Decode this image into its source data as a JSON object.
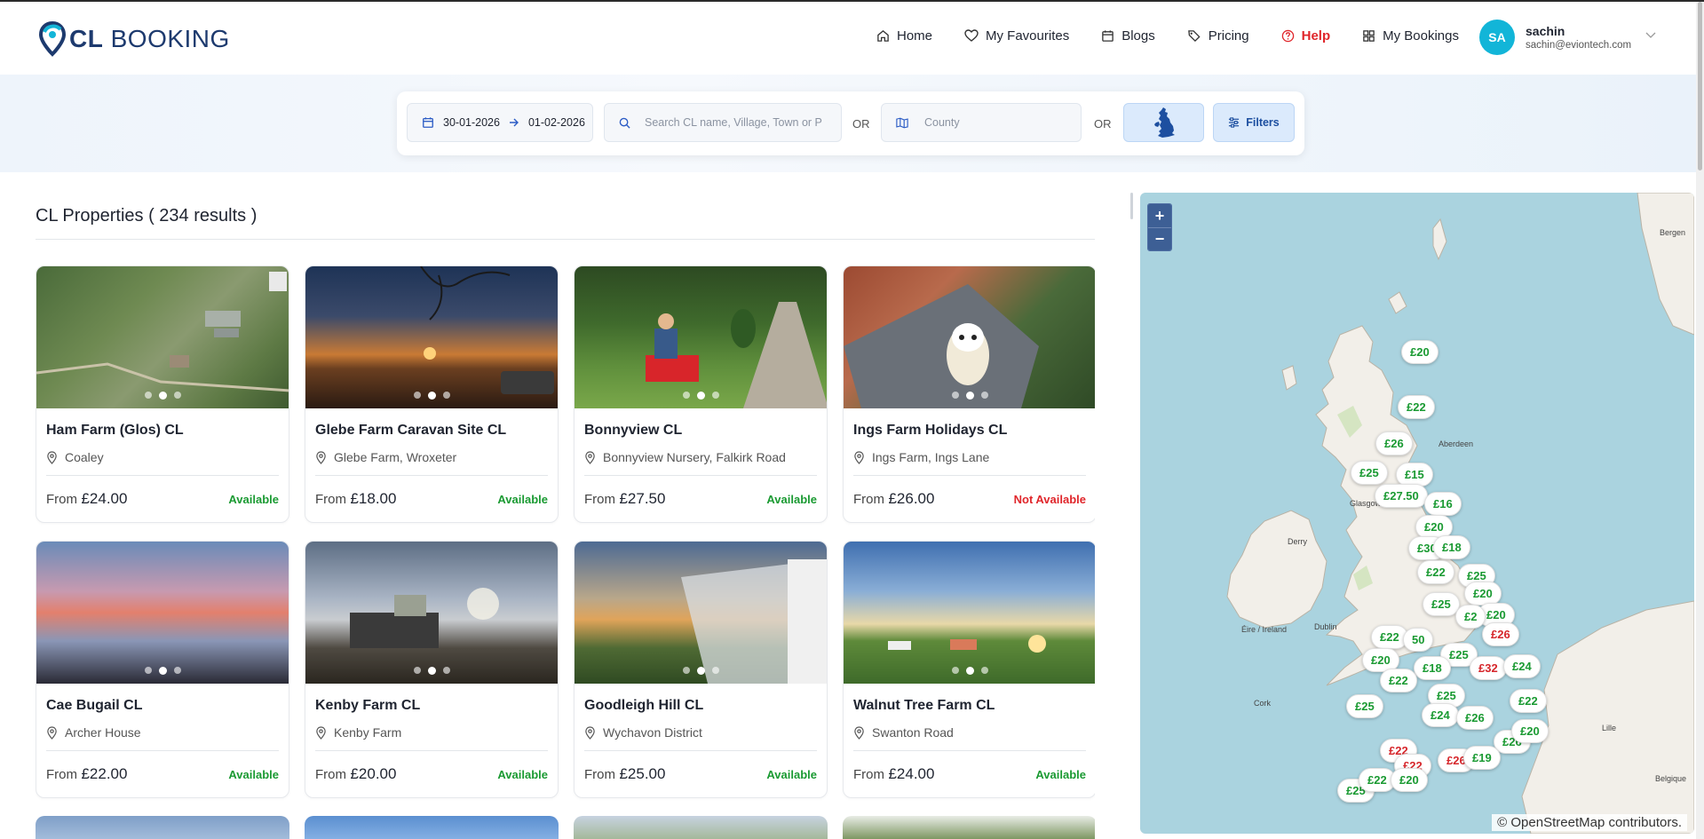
{
  "app": {
    "logo_bold": "CL",
    "logo_text": "BOOKING"
  },
  "nav": {
    "items": [
      {
        "label": "Home",
        "icon": "home-icon"
      },
      {
        "label": "My Favourites",
        "icon": "heart-icon"
      },
      {
        "label": "Blogs",
        "icon": "calendar-icon"
      },
      {
        "label": "Pricing",
        "icon": "tags-icon"
      },
      {
        "label": "Help",
        "icon": "help-icon"
      },
      {
        "label": "My Bookings",
        "icon": "grid-icon"
      }
    ]
  },
  "user": {
    "initials": "SA",
    "name": "sachin",
    "email": "sachin@eviontech.com"
  },
  "search": {
    "date_from": "30-01-2026",
    "date_to": "01-02-2026",
    "name_placeholder": "Search CL name, Village, Town or P",
    "or_1": "OR",
    "county_placeholder": "County",
    "or_2": "OR",
    "filters_label": "Filters"
  },
  "results": {
    "title": "CL Properties ( 234 results )"
  },
  "cards": [
    {
      "title": "Ham Farm (Glos) CL",
      "location": "Coaley",
      "price_prefix": "From",
      "price": "£24.00",
      "status": "Available"
    },
    {
      "title": "Glebe Farm Caravan Site CL",
      "location": "Glebe Farm, Wroxeter",
      "price_prefix": "From",
      "price": "£18.00",
      "status": "Available"
    },
    {
      "title": "Bonnyview CL",
      "location": "Bonnyview Nursery, Falkirk Road",
      "price_prefix": "From",
      "price": "£27.50",
      "status": "Available"
    },
    {
      "title": "Ings Farm Holidays CL",
      "location": "Ings Farm, Ings Lane",
      "price_prefix": "From",
      "price": "£26.00",
      "status": "Not Available"
    },
    {
      "title": "Cae Bugail CL",
      "location": "Archer House",
      "price_prefix": "From",
      "price": "£22.00",
      "status": "Available"
    },
    {
      "title": "Kenby Farm CL",
      "location": "Kenby Farm",
      "price_prefix": "From",
      "price": "£20.00",
      "status": "Available"
    },
    {
      "title": "Goodleigh Hill CL",
      "location": "Wychavon District",
      "price_prefix": "From",
      "price": "£25.00",
      "status": "Available"
    },
    {
      "title": "Walnut Tree Farm CL",
      "location": "Swanton Road",
      "price_prefix": "From",
      "price": "£24.00",
      "status": "Available"
    }
  ],
  "map": {
    "zoom_in": "+",
    "zoom_out": "−",
    "attribution": "© OpenStreetMap contributors.",
    "labels": [
      "Bergen",
      "Glasgow",
      "Aberdeen",
      "Dublin",
      "Éire / Ireland",
      "Cork",
      "Derry",
      "Lille",
      "Belgique"
    ],
    "markers": [
      {
        "text": "£20",
        "red": false
      },
      {
        "text": "£22",
        "red": false
      },
      {
        "text": "£26",
        "red": false
      },
      {
        "text": "£25",
        "red": false
      },
      {
        "text": "£15",
        "red": false
      },
      {
        "text": "£27.50",
        "red": false
      },
      {
        "text": "£16",
        "red": false
      },
      {
        "text": "£20",
        "red": false
      },
      {
        "text": "£30",
        "red": false
      },
      {
        "text": "£18",
        "red": false
      },
      {
        "text": "£22",
        "red": false
      },
      {
        "text": "£25",
        "red": false
      },
      {
        "text": "£20",
        "red": false
      },
      {
        "text": "£25",
        "red": false
      },
      {
        "text": "£20",
        "red": false
      },
      {
        "text": "£2",
        "red": false
      },
      {
        "text": "£26",
        "red": true
      },
      {
        "text": "£22",
        "red": false
      },
      {
        "text": "50",
        "red": false
      },
      {
        "text": "£25",
        "red": false
      },
      {
        "text": "£20",
        "red": false
      },
      {
        "text": "£18",
        "red": false
      },
      {
        "text": "£32",
        "red": true
      },
      {
        "text": "£24",
        "red": false
      },
      {
        "text": "£22",
        "red": false
      },
      {
        "text": "£25",
        "red": false
      },
      {
        "text": "£22",
        "red": false
      },
      {
        "text": "£25",
        "red": false
      },
      {
        "text": "£24",
        "red": false
      },
      {
        "text": "£26",
        "red": false
      },
      {
        "text": "£26",
        "red": false
      },
      {
        "text": "£20",
        "red": false
      },
      {
        "text": "£22",
        "red": true
      },
      {
        "text": "£22",
        "red": true
      },
      {
        "text": "£26",
        "red": true
      },
      {
        "text": "£19",
        "red": false
      },
      {
        "text": "£25",
        "red": false
      },
      {
        "text": "£22",
        "red": false
      },
      {
        "text": "£20",
        "red": false
      }
    ]
  }
}
